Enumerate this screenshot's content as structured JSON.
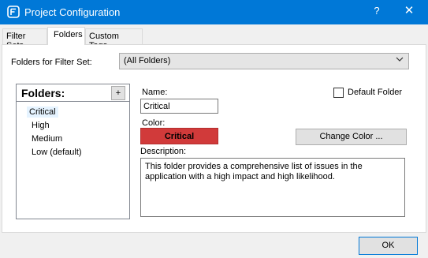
{
  "window": {
    "title": "Project Configuration",
    "help_glyph": "?",
    "close_glyph": "✕",
    "accent_color": "#0078d7"
  },
  "tabs": [
    {
      "label": "Filter Sets"
    },
    {
      "label": "Folders"
    },
    {
      "label": "Custom Tags"
    }
  ],
  "filter": {
    "label": "Folders for Filter Set:",
    "selected": "(All Folders)"
  },
  "folders": {
    "header": "Folders:",
    "add_label": "+",
    "items": [
      {
        "label": "Critical"
      },
      {
        "label": "High"
      },
      {
        "label": "Medium"
      },
      {
        "label": "Low (default)"
      }
    ]
  },
  "details": {
    "name_label": "Name:",
    "name_value": "Critical",
    "default_label": "Default Folder",
    "color_label": "Color:",
    "color_value": "Critical",
    "color_hex": "#d13a3a",
    "change_color_label": "Change Color ...",
    "description_label": "Description:",
    "description_value": "This folder provides a comprehensive list of issues in the application with a high impact and high likelihood."
  },
  "footer": {
    "ok_label": "OK"
  }
}
